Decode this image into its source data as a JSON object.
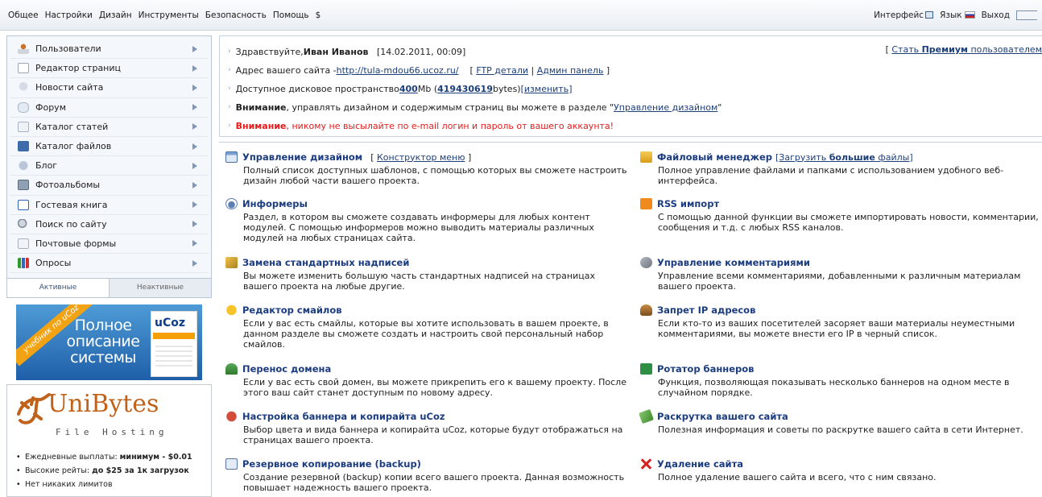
{
  "topmenu": {
    "items": [
      "Общее",
      "Настройки",
      "Дизайн",
      "Инструменты",
      "Безопасность",
      "Помощь",
      "$"
    ],
    "interface_label": "Интерфейс",
    "language_label": "Язык",
    "logout_label": "Выход"
  },
  "sidebar": {
    "items": [
      {
        "label": "Пользователи",
        "icon": "users-icon"
      },
      {
        "label": "Редактор страниц",
        "icon": "page-editor-icon"
      },
      {
        "label": "Новости сайта",
        "icon": "news-icon"
      },
      {
        "label": "Форум",
        "icon": "forum-icon"
      },
      {
        "label": "Каталог статей",
        "icon": "articles-icon"
      },
      {
        "label": "Каталог файлов",
        "icon": "files-catalog-icon"
      },
      {
        "label": "Блог",
        "icon": "blog-icon"
      },
      {
        "label": "Фотоальбомы",
        "icon": "photo-album-icon"
      },
      {
        "label": "Гостевая книга",
        "icon": "guestbook-icon"
      },
      {
        "label": "Поиск по сайту",
        "icon": "search-icon"
      },
      {
        "label": "Почтовые формы",
        "icon": "mail-form-icon"
      },
      {
        "label": "Опросы",
        "icon": "poll-icon"
      }
    ],
    "tabs": {
      "active": "Активные",
      "inactive": "Неактивные"
    }
  },
  "banner_ucoz": {
    "ribbon": "учебник по uCoz",
    "text": "Полное описание системы",
    "book_logo": "uCoz"
  },
  "banner_unibytes": {
    "title": "UniBytes",
    "subtitle": "File Hosting",
    "items": [
      {
        "text": "Ежедневные выплаты: ",
        "bold": "минимум - $0.01"
      },
      {
        "text": "Высокие рейты: ",
        "bold": "до $25 за 1к загрузок"
      },
      {
        "text": "Нет никаких лимитов",
        "bold": ""
      }
    ]
  },
  "info": {
    "greeting_prefix": "Здравствуйте, ",
    "user_name": "Иван Иванов",
    "datetime": "[14.02.2011, 00:09]",
    "site_address_label": "Адрес вашего сайта - ",
    "site_url": "http://tula-mdou66.ucoz.ru/",
    "ftp_link": "FTP детали",
    "admin_link": "Админ панель",
    "space_prefix": "Доступное дисковое пространство ",
    "space_mb": "400",
    "space_mb_unit": " Mb (",
    "space_bytes": "419430619",
    "space_bytes_unit": " bytes) ",
    "change_link": "[изменить]",
    "attention1_bold": "Внимание",
    "attention1_text": ", управлять дизайном и содержимым страниц вы можете в разделе \"",
    "attention1_link": "Управление дизайном",
    "attention1_end": "\"",
    "attention2_bold": "Внимание",
    "attention2_text": ", никому не высылайте по e-mail логин и пароль от вашего аккаунта!",
    "premium_prefix": "Стать ",
    "premium_bold": "Премиум",
    "premium_suffix": " пользователем"
  },
  "modules_left": [
    {
      "title": "Управление дизайном",
      "extra": "Конструктор меню",
      "desc": "Полный список доступных шаблонов, с помощью которых вы сможете настроить дизайн любой части вашего проекта.",
      "icon": "design-icon"
    },
    {
      "title": "Информеры",
      "extra": "",
      "desc": "Раздел, в котором вы сможете создавать информеры для любых контент модулей. С помощью информеров можно выводить материалы различных модулей на любых страницах сайта.",
      "icon": "informer-icon"
    },
    {
      "title": "Замена стандартных надписей",
      "extra": "",
      "desc": "Вы можете изменить большую часть стандартных надписей на страницах вашего проекта на любые другие.",
      "icon": "replace-text-icon"
    },
    {
      "title": "Редактор смайлов",
      "extra": "",
      "desc": "Если у вас есть смайлы, которые вы хотите использовать в вашем проекте, в данном разделе вы сможете создать и настроить свой персональный набор смайлов.",
      "icon": "smile-icon"
    },
    {
      "title": "Перенос домена",
      "extra": "",
      "desc": "Если у вас есть свой домен, вы можете прикрепить его к вашему проекту. После этого ваш сайт станет доступным по новому адресу.",
      "icon": "domain-icon"
    },
    {
      "title": "Настройка баннера и копирайта uCoz",
      "extra": "",
      "desc": "Выбор цвета и вида баннера и копирайта uCoz, которые будут отображаться на страницах вашего проекта.",
      "icon": "banner-settings-icon"
    },
    {
      "title": "Резервное копирование (backup)",
      "extra": "",
      "desc": "Создание резервной (backup) копии всего вашего проекта. Данная возможность повышает надежность вашего проекта.",
      "icon": "backup-icon"
    }
  ],
  "modules_right": [
    {
      "title": "Файловый менеджер",
      "extra_pre": "[Загрузить ",
      "extra_bold": "большие",
      "extra_post": " файлы]",
      "desc": "Полное управление файлами и папками с использованием удобного веб-интерфейса.",
      "icon": "file-manager-icon"
    },
    {
      "title": "RSS импорт",
      "desc": "С помощью данной функции вы сможете импортировать новости, комментарии, сообщения и т.д. с любых RSS каналов.",
      "icon": "rss-icon"
    },
    {
      "title": "Управление комментариями",
      "desc": "Управление всеми комментариями, добавленными к различным материалам вашего проекта.",
      "icon": "comments-icon"
    },
    {
      "title": "Запрет IP адресов",
      "desc": "Если кто-то из ваших посетителей засоряет ваши материалы неуместными комментариями, вы можете внести его IP в черный список.",
      "icon": "ip-ban-icon"
    },
    {
      "title": "Ротатор баннеров",
      "desc": "Функция, позволяющая показывать несколько баннеров на одном месте в случайном порядке.",
      "icon": "banner-rotator-icon"
    },
    {
      "title": "Раскрутка вашего сайта",
      "desc": "Полезная информация и советы по раскрутке вашего сайта в сети Интернет.",
      "icon": "promotion-icon"
    },
    {
      "title": "Удаление сайта",
      "desc": "Полное удаление вашего сайта и всего, что с ним связано.",
      "icon": "delete-icon"
    }
  ]
}
